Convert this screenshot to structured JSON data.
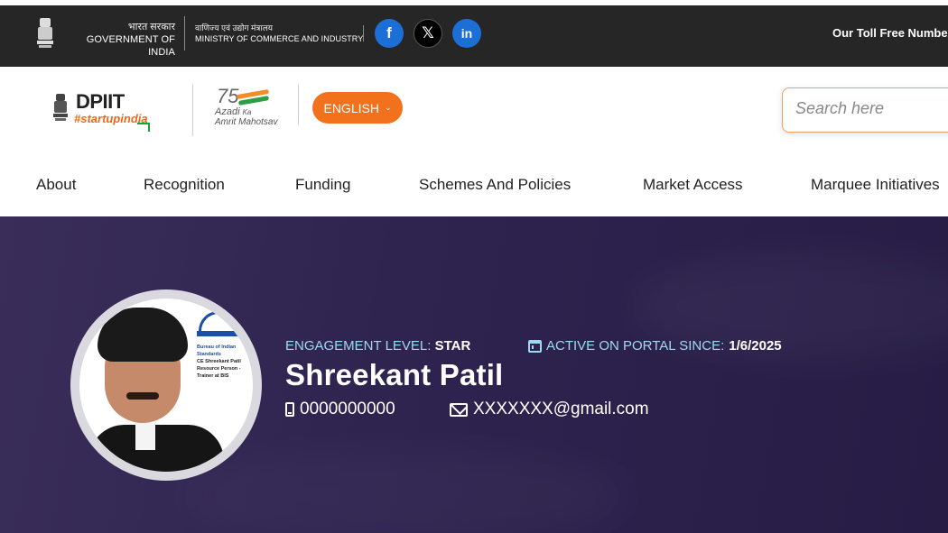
{
  "gov_bar": {
    "gov_hindi": "भारत सरकार",
    "gov_english": "GOVERNMENT OF INDIA",
    "ministry_hindi": "वाणिज्य एवं उद्योग मंत्रालय",
    "ministry_english": "MINISTRY OF COMMERCE AND INDUSTRY",
    "social": [
      {
        "name": "facebook",
        "glyph": "f"
      },
      {
        "name": "x",
        "glyph": "𝕏"
      },
      {
        "name": "linkedin",
        "glyph": "in"
      }
    ],
    "toll_free": "Our Toll Free Numbe"
  },
  "header": {
    "brand_title": "DPIIT",
    "brand_tag": "#startupindia",
    "azadi_75": "75",
    "azadi_line1": "Azadi",
    "azadi_ka": "Ka",
    "azadi_line2": "Amrit Mahotsav",
    "language": "ENGLISH",
    "search_placeholder": "Search here"
  },
  "nav": {
    "items": [
      "About",
      "Recognition",
      "Funding",
      "Schemes And Policies",
      "Market Access",
      "Marquee Initiatives"
    ]
  },
  "profile": {
    "engagement_label": "ENGAGEMENT LEVEL:",
    "engagement_value": "STAR",
    "active_label": "ACTIVE ON PORTAL SINCE:",
    "active_value": "1/6/2025",
    "name": "Shreekant Patil",
    "phone": "0000000000",
    "email": "XXXXXXX@gmail.com",
    "photo_caption": "CE Shreekant Patil Resource Person - Trainer at BIS",
    "photo_org": "Bureau of Indian Standards"
  },
  "colors": {
    "top_bar": "#262626",
    "accent_orange": "#f2711c",
    "hero_bg": "#2f2450",
    "label_blue": "#9fd8f2"
  }
}
